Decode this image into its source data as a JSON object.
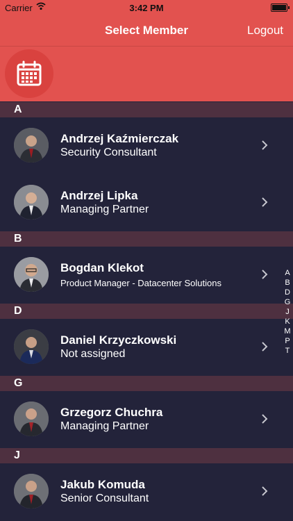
{
  "status_bar": {
    "carrier": "Carrier",
    "time": "3:42 PM"
  },
  "nav": {
    "title": "Select Member",
    "logout_label": "Logout"
  },
  "colors": {
    "accent": "#e2524f",
    "background": "#23233a",
    "section": "#4e3040"
  },
  "sections": [
    {
      "letter": "A",
      "members": [
        {
          "name": "Andrzej Kaźmierczak",
          "role": "Security Consultant"
        },
        {
          "name": "Andrzej Lipka",
          "role": "Managing Partner"
        }
      ]
    },
    {
      "letter": "B",
      "members": [
        {
          "name": "Bogdan Klekot",
          "role": "Product Manager - Datacenter Solutions"
        }
      ]
    },
    {
      "letter": "D",
      "members": [
        {
          "name": "Daniel Krzyczkowski",
          "role": "Not assigned"
        }
      ]
    },
    {
      "letter": "G",
      "members": [
        {
          "name": "Grzegorz Chuchra",
          "role": "Managing Partner"
        }
      ]
    },
    {
      "letter": "J",
      "members": [
        {
          "name": "Jakub Komuda",
          "role": "Senior Consultant"
        }
      ]
    }
  ],
  "index_letters": [
    "A",
    "B",
    "D",
    "G",
    "J",
    "K",
    "M",
    "P",
    "T"
  ]
}
